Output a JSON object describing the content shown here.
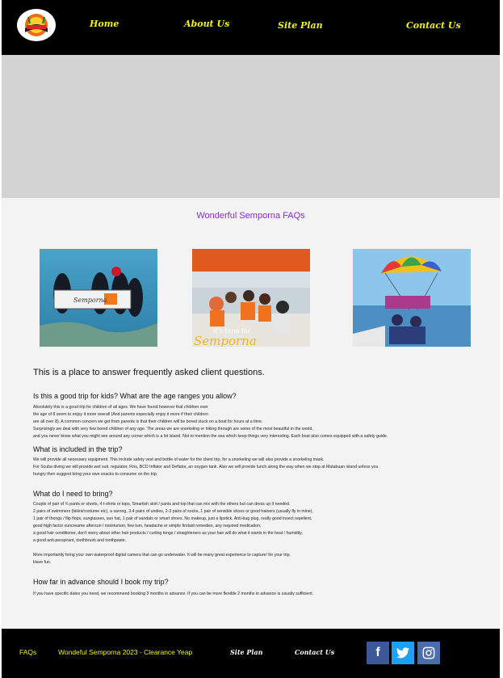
{
  "nav": {
    "home": "Home",
    "about": "About Us",
    "site_plan": "Site Plan",
    "contact": "Contact Us"
  },
  "page_title": "Wonderful Semporna FAQs",
  "photos": {
    "photo2_caption": "it's time for",
    "photo2_caption_big": "Semporna"
  },
  "intro": "This is a place to answer frequently asked client questions.",
  "faq": [
    {
      "question": "Is this a good trip for kids? What are the age ranges you allow?",
      "answer_lines": [
        "Absolutely this is a good trip for children of all ages. We have found however that children over",
        "the age of 8 seem to enjoy it more overall (And parents especially enjoy it more if their children",
        "are all over 8). A common concern we get from parents is that their children will be bored stuck on a boat for hours at a time.",
        "Surprisingly we deal with very few bored children of any age. The areas we are snorkeling or hiking through are some of the most beautiful in the world,",
        "and you never know what you might see around any corner which is a lot island. Not to mention the sea which keep things very interesting. Each boat also comes equipped with a safety guide."
      ]
    },
    {
      "question": "What is included in the trip?",
      "answer_lines": [
        "We will provide all necessary equipment. This include safety vest and bottle of water for the client trip, for a snorkeling we will also provide a snorkeling mask.",
        "For Scuba diving we will provide wet suit, regulator, Fins, BCD Inflator and Deflator, an oxygen tank. Also we will provide lunch along the way when we stop at Matabuan island unless you",
        "hungry then suggest bring your own snacks to consume on the trip."
      ]
    },
    {
      "question": "What do I need to bring?",
      "answer_lines": [
        "Couple of pair of ¾ pants or shorts, 4 t-shirts or tops, Smartish skirt / pants and top that can mix with the others but can dress up if needed.",
        "2 pairs of swimmers (bikini/costume etc), a sarong, 3-4 pairs of undies, 2-3 pairs of socks, 1 pair of sensible shoes or good trainers (usually fly in mine),",
        "1 pair of thongs / flip flops, sunglasses, sun hat, 1 pair of sandals or smart shoes. No makeup, just a lipstick. Anti-bug plug, really good insect repellent,",
        "good high factor suncreame aftersun / moisturiser, few tum, headache or simple firstaid remedies, any required medication,",
        "a good hair conditioner, don't worry about other hair products / curling tongs / straighteners as your hair will do what it wants in the heat / humidity,",
        "a good anti-perspirant, toothbrush and toothpaste.",
        "",
        "More importantly bring your own waterproof digital camera that can go underwater. It will be many great experience to capture! for your trip.",
        "Have fun."
      ]
    },
    {
      "question": "How far in advance should I book my trip?",
      "answer_lines": [
        "If you have specific dates you need, we recommend booking 3 months in advance. If you can be more flexible 2 months in advance is usually sufficient."
      ]
    }
  ],
  "footer": {
    "faqs": "FAQs",
    "copyright": "Wondeful Semporna 2023 - Clearance Yeap",
    "site_plan": "Site Plan",
    "contact": "Contact Us"
  },
  "social": {
    "facebook_glyph": "f",
    "facebook_color": "#3b5998",
    "twitter_color": "#1da1f2",
    "instagram_color": "#4a6ea9"
  }
}
